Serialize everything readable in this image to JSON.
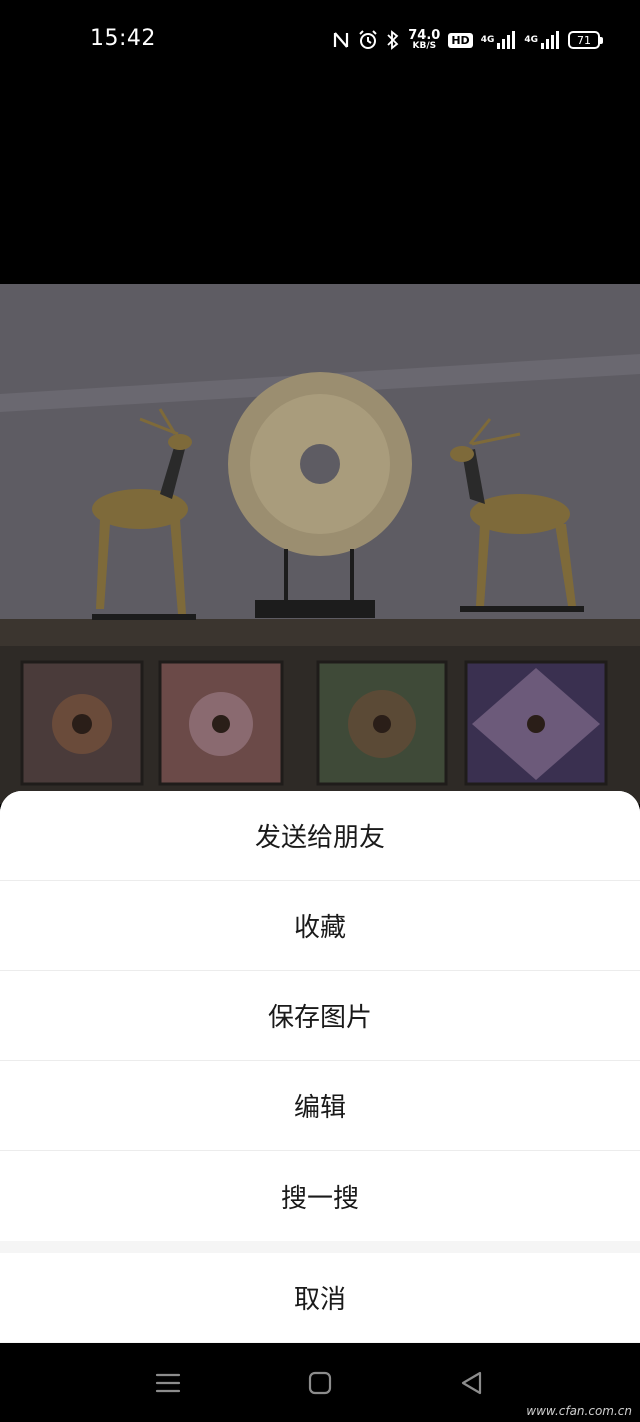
{
  "status_bar": {
    "time": "15:42",
    "speed_value": "74.0",
    "speed_unit": "KB/S",
    "hd_label": "HD",
    "net1_label": "4G",
    "net2_label": "4G",
    "battery_level": "71",
    "icons": [
      "nfc-icon",
      "alarm-icon",
      "bluetooth-icon",
      "signal-icon",
      "battery-icon"
    ]
  },
  "action_sheet": {
    "items": [
      {
        "label": "发送给朋友"
      },
      {
        "label": "收藏"
      },
      {
        "label": "保存图片"
      },
      {
        "label": "编辑"
      },
      {
        "label": "搜一搜"
      }
    ],
    "cancel_label": "取消"
  },
  "nav_bar": {
    "icons": [
      "menu-icon",
      "home-icon",
      "back-icon"
    ]
  },
  "watermark": "www.cfan.com.cn",
  "colors": {
    "background": "#000000",
    "sheet_bg": "#ffffff",
    "separator": "#ececec",
    "text": "#1a1a1a"
  }
}
